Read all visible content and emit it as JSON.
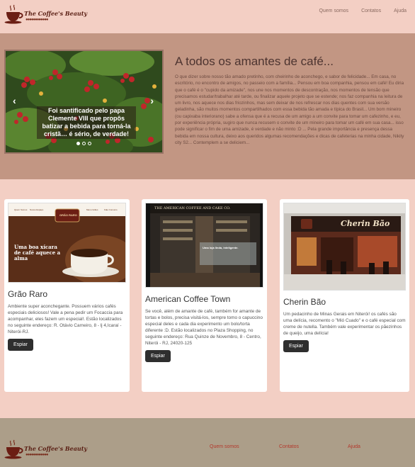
{
  "brand": {
    "name": "The Coffee's Beauty"
  },
  "nav": {
    "items": [
      "Quem somos",
      "Contatos",
      "Ajuda"
    ]
  },
  "hero": {
    "carousel": {
      "caption": "Foi santificado pelo papa Clemente VIII que propôs batizar a bebida para torná-la cristã… é sério, de verdade!",
      "prev_icon": "‹",
      "next_icon": "›"
    },
    "title": "A todos os amantes de café...",
    "text": "O que dizer sobre nosso tão amado pretinho, com cheirinho de aconchego, e sabor de felicidade... Em casa, no escritório, no encontro de amigos, no passeio com a família... Pensou em boa companhia, pensou em café! Eu diria que o café é o \"cupido da amizade\", nos une nos momentos de descontração, nos momentos de tensão que precisamos estudar/trabalhar até tarde, ou finalizar aquele projeto que se estende; nos faz companhia na leitura de um livro, nos aquece nos dias friozinhos, mas sem deixar de nos refrescar nos dias quentes com sua versão geladinha, são muitos momentos compartilhados com essa bebida tão amada e típica do Brasil... Um bom mineiro (ou capixaba interiorano) sabe a ofensa que é a recusa de um amigo a um convite para tomar um cafezinho, e eu, por experiência própria, sugiro que nunca recusem o convite de um mineiro para tomar um café em sua casa... isso pode significar o fim de uma amizade, é verdade e não minto :D ... Pela grande importância e presença dessa bebida em nossa cultura, deixo aos queridos algumas recomendações e dicas de cafeterias na minha cidade, Nikity city S2... Contemplem a se deliciem..."
  },
  "cards": [
    {
      "title": "Grão Raro",
      "text": "Ambiente super aconchegante. Possuem vários cafés especiais deliciosos! Vale a pena pedir um Focaccia para acompanhar, eles fazem um especial!. Estão localizados no seguinte endereço: R. Otávio Carneiro, 8 - lj 4,Icaraí - Niterói-RJ.",
      "button": "Espiar",
      "image": {
        "menu": [
          "Quem Somos",
          "Nosso Espaço",
          "Menu Grãos",
          "Fale Conosco"
        ],
        "logo_text": "GRÃO RARO",
        "tagline": "Uma boa xícara de café aquece a alma"
      }
    },
    {
      "title": "American Coffee Town",
      "text": "Se você, além de amante de café, também for amante de tortas e bolos, precisa visitá-los, sempre tomo o capuccino especial deles e cada dia experimento um bolo/torta diferente :D. Estão localizados no Plaza Shopping, no seguinte endereço: Rua Quinze de Novembro, 8 - Centro, Niterói - RJ, 24020-125",
      "button": "Espiar",
      "image": {
        "sign": "THE AMERICAN COFFEE AND CAKE CO.",
        "overlay": "Uma loja linda, inteligente."
      }
    },
    {
      "title": "Cherin Bão",
      "text": "Um pedacinho de Minas Gerais em Niterói! os cafés são uma delícia, recomento o \"Mió Cuado\" e o café especial com creme de nutella. Também vale experimentar os pãezinhos de queijo, uma delícia!",
      "button": "Espiar",
      "image": {
        "sign": "Cherin Bão"
      }
    }
  ],
  "footer": {
    "links": [
      "Quem somos",
      "Contatos",
      "Ajuda"
    ]
  },
  "colors": {
    "page_bg": "#f3cfc4",
    "hero_bg": "#c29683",
    "footer_bg": "#ac9e89",
    "button_bg": "#2e2e2e",
    "footer_link": "#b3382c"
  }
}
